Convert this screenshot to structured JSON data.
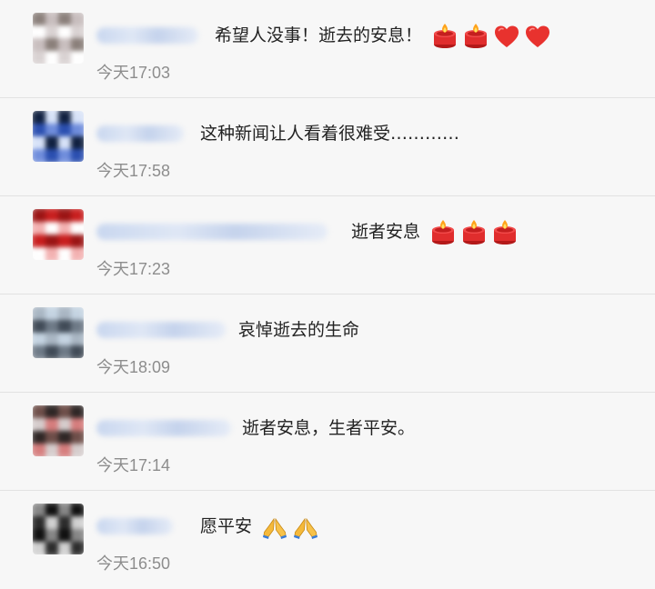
{
  "comments": [
    {
      "text": "希望人没事！逝去的安息！",
      "time": "今天17:03",
      "emojis": [
        "candle-icon",
        "candle-icon",
        "heart-icon",
        "heart-icon"
      ],
      "avatar_colors": [
        "#8a7f7a",
        "#d9d2d2",
        "#c8bebe",
        "#ffffff"
      ]
    },
    {
      "text": "这种新闻让人看着很难受…………",
      "time": "今天17:58",
      "emojis": [],
      "avatar_colors": [
        "#2b4fb0",
        "#10203f",
        "#6f8ddc",
        "#d8e3f8"
      ]
    },
    {
      "text": "逝者安息",
      "time": "今天17:23",
      "emojis": [
        "candle-icon",
        "candle-icon",
        "candle-icon"
      ],
      "avatar_colors": [
        "#c81e1e",
        "#f3b1b1",
        "#9a1414",
        "#ffffff"
      ]
    },
    {
      "text": "哀悼逝去的生命",
      "time": "今天18:09",
      "emojis": [],
      "avatar_colors": [
        "#6e7a87",
        "#c5d4e2",
        "#404a56",
        "#a9b6c3"
      ]
    },
    {
      "text": "逝者安息，生者平安。",
      "time": "今天17:14",
      "emojis": [],
      "avatar_colors": [
        "#6e4e49",
        "#d67d7d",
        "#2e2625",
        "#d6cdcd"
      ]
    },
    {
      "text": "愿平安",
      "time": "今天16:50",
      "emojis": [
        "pray-icon",
        "pray-icon"
      ],
      "avatar_colors": [
        "#2b2b2b",
        "#878787",
        "#d2d2d2",
        "#101010"
      ]
    }
  ],
  "colors": {
    "background": "#f7f7f7",
    "text": "#222222",
    "time": "#8d8d8d",
    "name_blur": "#c9d7ef",
    "divider": "#e2e2e2"
  }
}
